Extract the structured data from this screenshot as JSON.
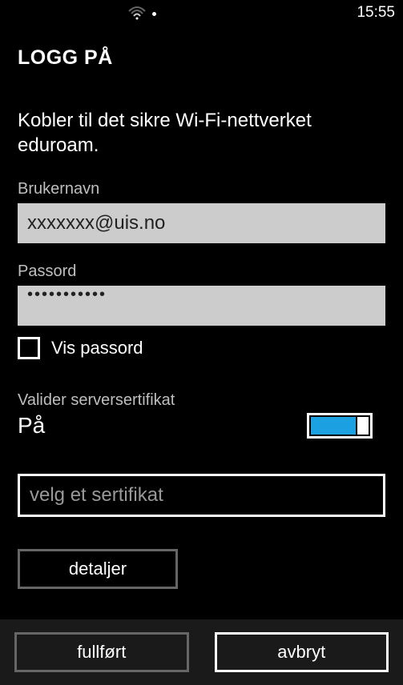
{
  "statusbar": {
    "time": "15:55"
  },
  "page": {
    "title": "LOGG PÅ",
    "description": "Kobler til det sikre Wi-Fi-nettverket eduroam."
  },
  "username": {
    "label": "Brukernavn",
    "value": "xxxxxxx@uis.no"
  },
  "password": {
    "label": "Passord",
    "value": "•••••••••••"
  },
  "show_password": {
    "label": "Vis passord"
  },
  "validate_cert": {
    "label": "Valider serversertifikat",
    "value": "På"
  },
  "cert_select": {
    "placeholder": "velg et sertifikat"
  },
  "details_button": "detaljer",
  "bottom": {
    "done": "fullført",
    "cancel": "avbryt"
  }
}
